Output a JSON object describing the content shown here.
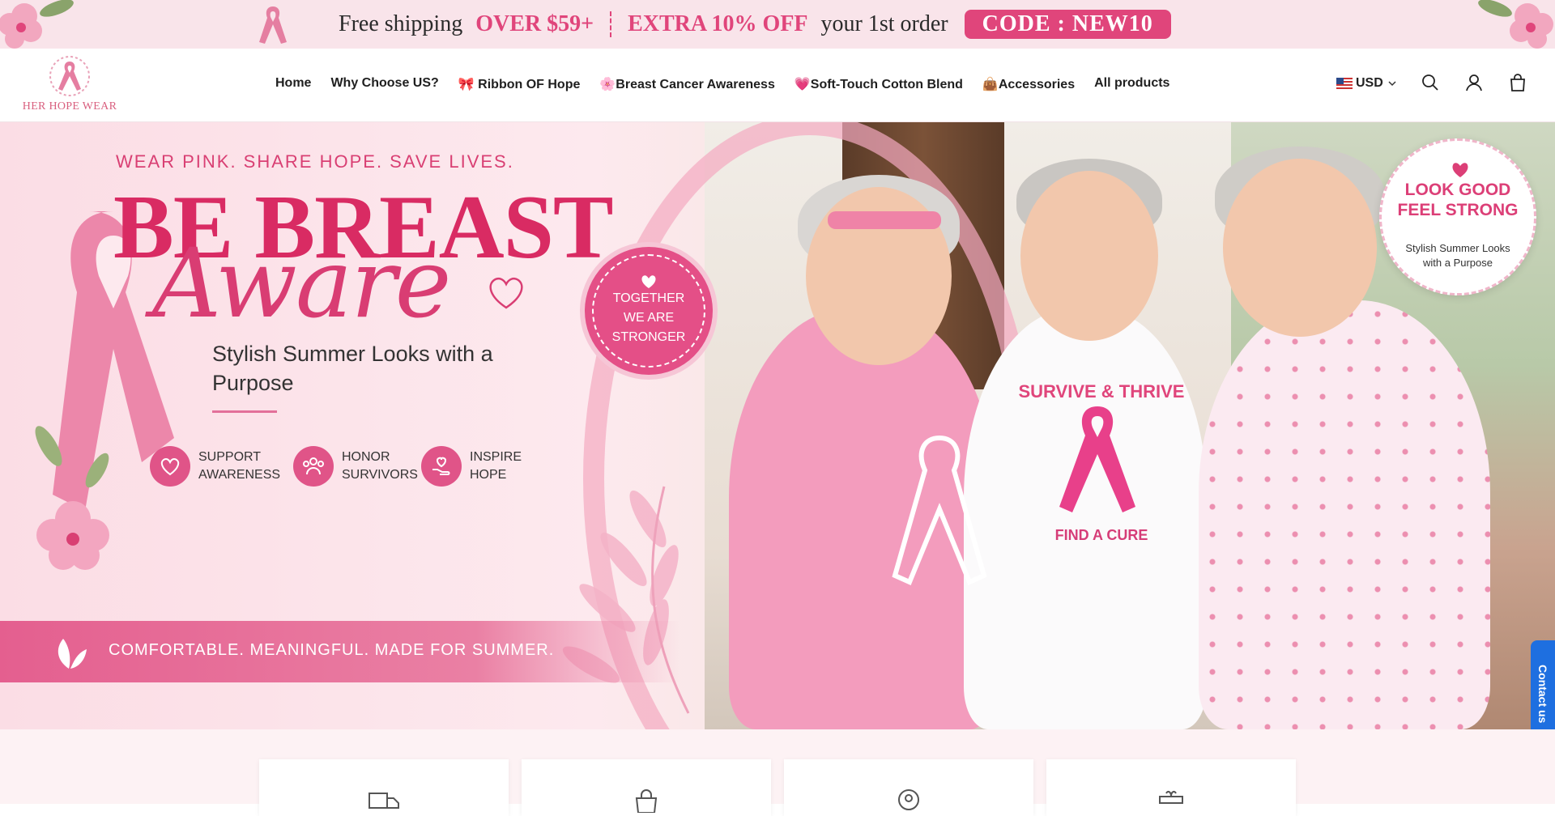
{
  "announcement": {
    "part1": "Free shipping",
    "part2": "OVER $59+",
    "part3": "EXTRA 10% OFF",
    "part4": "your 1st order",
    "code": "CODE :  NEW10",
    "icon": "ribbon-icon"
  },
  "header": {
    "logo_text": "HER HOPE WEAR",
    "nav": [
      {
        "label": "Home"
      },
      {
        "label": "Why Choose US?"
      },
      {
        "label": "🎀 Ribbon OF Hope"
      },
      {
        "label": "🌸Breast Cancer Awareness"
      },
      {
        "label": "💗Soft-Touch Cotton Blend"
      },
      {
        "label": "👜Accessories"
      },
      {
        "label": "All products"
      }
    ],
    "currency": "USD",
    "icons": [
      "search-icon",
      "account-icon",
      "cart-icon"
    ]
  },
  "hero": {
    "tagline": "WEAR PINK. SHARE HOPE. SAVE LIVES.",
    "title_line1": "BE BREAST",
    "title_line2": "Aware",
    "subtitle": "Stylish Summer Looks with a Purpose",
    "features": [
      {
        "icon": "heart-icon",
        "line1": "SUPPORT",
        "line2": "AWARENESS"
      },
      {
        "icon": "people-icon",
        "line1": "HONOR",
        "line2": "SURVIVORS"
      },
      {
        "icon": "hand-heart-icon",
        "line1": "INSPIRE",
        "line2": "HOPE"
      }
    ],
    "stripe_text": "COMFORTABLE. MEANINGFUL. MADE FOR SUMMER.",
    "badge": {
      "line1": "TOGETHER",
      "line2": "WE ARE",
      "line3": "STRONGER"
    },
    "look": {
      "line1": "LOOK GOOD",
      "line2": "FEEL STRONG",
      "line3": "Stylish Summer Looks",
      "line4": "with a Purpose"
    },
    "shirt_top": "SURVIVE & THRIVE",
    "shirt_bottom": "FIND A CURE"
  },
  "contact": {
    "label": "Contact us"
  },
  "services": {
    "icons": [
      "truck-icon",
      "bag-icon",
      "location-icon",
      "gift-icon"
    ]
  },
  "colors": {
    "accent": "#e0457b",
    "announce_bg": "#f9e4ea",
    "contact": "#1e6fe0"
  }
}
